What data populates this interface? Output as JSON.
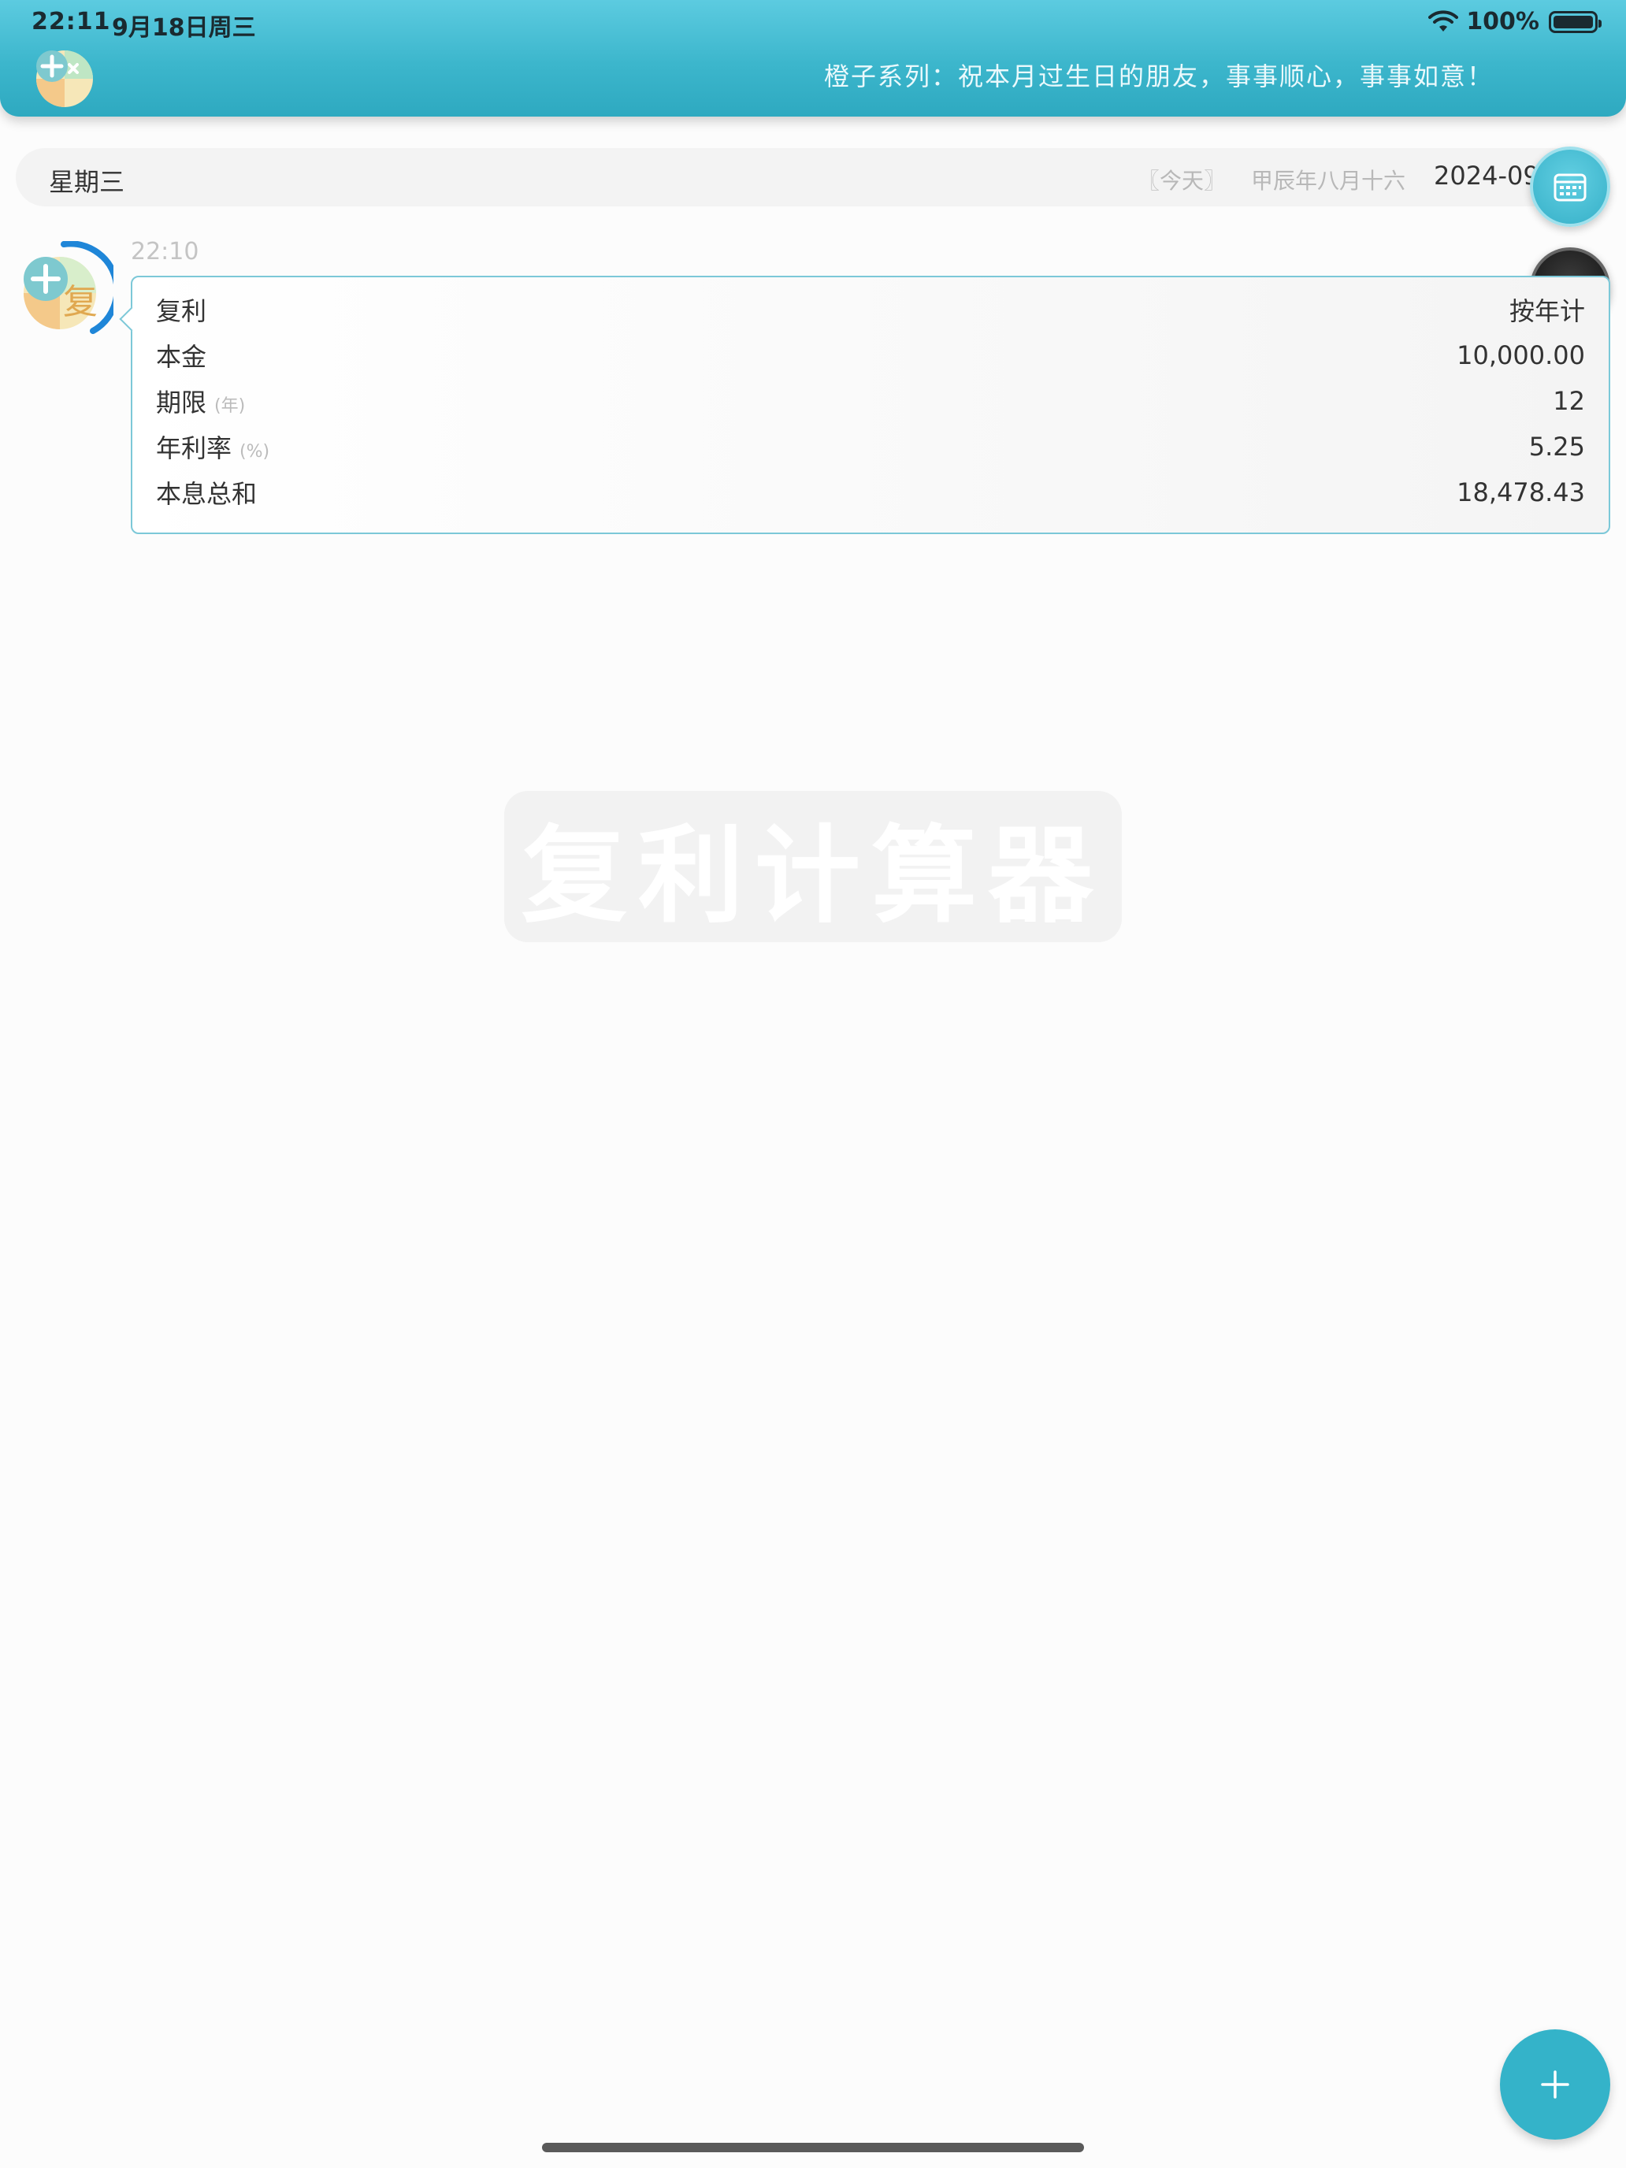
{
  "status_bar": {
    "time": "22:11",
    "date": "9月18日周三",
    "battery": "100%"
  },
  "header": {
    "marquee": "橙子系列：祝本月过生日的朋友，事事顺心，事事如意！",
    "accent_color": "#3cb6cc"
  },
  "date_bar": {
    "weekday": "星期三",
    "today_tag": "〖今天〗",
    "lunar_date": "甲辰年八月十六",
    "gregorian_date": "2024-09"
  },
  "message": {
    "time": "22:10",
    "rows": [
      {
        "label": "复利",
        "unit": "",
        "value": "按年计"
      },
      {
        "label": "本金",
        "unit": "",
        "value": "10,000.00"
      },
      {
        "label": "期限",
        "unit": "(年)",
        "value": "12"
      },
      {
        "label": "年利率",
        "unit": "(%)",
        "value": "5.25"
      },
      {
        "label": "本息总和",
        "unit": "",
        "value": "18,478.43"
      }
    ]
  },
  "watermark": {
    "text": "复利计算器"
  },
  "icons": {
    "calendar": "calendar-icon",
    "night_mode": "moon-icon",
    "add": "plus-icon",
    "wifi": "wifi-icon",
    "battery": "battery-icon"
  }
}
